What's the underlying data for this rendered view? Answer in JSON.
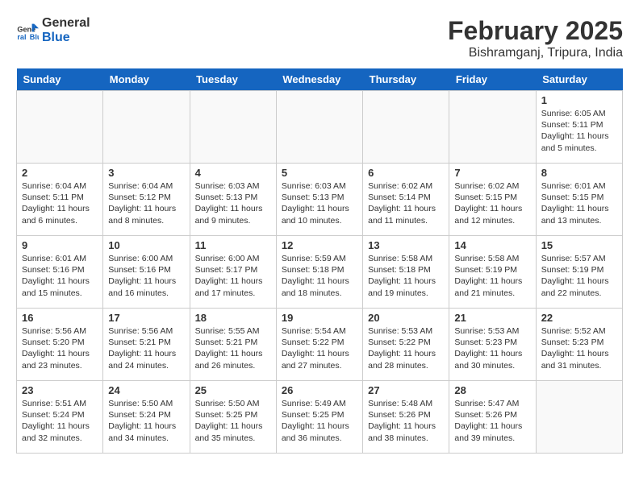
{
  "header": {
    "logo_line1": "General",
    "logo_line2": "Blue",
    "month": "February 2025",
    "location": "Bishramganj, Tripura, India"
  },
  "days_of_week": [
    "Sunday",
    "Monday",
    "Tuesday",
    "Wednesday",
    "Thursday",
    "Friday",
    "Saturday"
  ],
  "weeks": [
    [
      {
        "day": "",
        "info": ""
      },
      {
        "day": "",
        "info": ""
      },
      {
        "day": "",
        "info": ""
      },
      {
        "day": "",
        "info": ""
      },
      {
        "day": "",
        "info": ""
      },
      {
        "day": "",
        "info": ""
      },
      {
        "day": "1",
        "info": "Sunrise: 6:05 AM\nSunset: 5:11 PM\nDaylight: 11 hours and 5 minutes."
      }
    ],
    [
      {
        "day": "2",
        "info": "Sunrise: 6:04 AM\nSunset: 5:11 PM\nDaylight: 11 hours and 6 minutes."
      },
      {
        "day": "3",
        "info": "Sunrise: 6:04 AM\nSunset: 5:12 PM\nDaylight: 11 hours and 8 minutes."
      },
      {
        "day": "4",
        "info": "Sunrise: 6:03 AM\nSunset: 5:13 PM\nDaylight: 11 hours and 9 minutes."
      },
      {
        "day": "5",
        "info": "Sunrise: 6:03 AM\nSunset: 5:13 PM\nDaylight: 11 hours and 10 minutes."
      },
      {
        "day": "6",
        "info": "Sunrise: 6:02 AM\nSunset: 5:14 PM\nDaylight: 11 hours and 11 minutes."
      },
      {
        "day": "7",
        "info": "Sunrise: 6:02 AM\nSunset: 5:15 PM\nDaylight: 11 hours and 12 minutes."
      },
      {
        "day": "8",
        "info": "Sunrise: 6:01 AM\nSunset: 5:15 PM\nDaylight: 11 hours and 13 minutes."
      }
    ],
    [
      {
        "day": "9",
        "info": "Sunrise: 6:01 AM\nSunset: 5:16 PM\nDaylight: 11 hours and 15 minutes."
      },
      {
        "day": "10",
        "info": "Sunrise: 6:00 AM\nSunset: 5:16 PM\nDaylight: 11 hours and 16 minutes."
      },
      {
        "day": "11",
        "info": "Sunrise: 6:00 AM\nSunset: 5:17 PM\nDaylight: 11 hours and 17 minutes."
      },
      {
        "day": "12",
        "info": "Sunrise: 5:59 AM\nSunset: 5:18 PM\nDaylight: 11 hours and 18 minutes."
      },
      {
        "day": "13",
        "info": "Sunrise: 5:58 AM\nSunset: 5:18 PM\nDaylight: 11 hours and 19 minutes."
      },
      {
        "day": "14",
        "info": "Sunrise: 5:58 AM\nSunset: 5:19 PM\nDaylight: 11 hours and 21 minutes."
      },
      {
        "day": "15",
        "info": "Sunrise: 5:57 AM\nSunset: 5:19 PM\nDaylight: 11 hours and 22 minutes."
      }
    ],
    [
      {
        "day": "16",
        "info": "Sunrise: 5:56 AM\nSunset: 5:20 PM\nDaylight: 11 hours and 23 minutes."
      },
      {
        "day": "17",
        "info": "Sunrise: 5:56 AM\nSunset: 5:21 PM\nDaylight: 11 hours and 24 minutes."
      },
      {
        "day": "18",
        "info": "Sunrise: 5:55 AM\nSunset: 5:21 PM\nDaylight: 11 hours and 26 minutes."
      },
      {
        "day": "19",
        "info": "Sunrise: 5:54 AM\nSunset: 5:22 PM\nDaylight: 11 hours and 27 minutes."
      },
      {
        "day": "20",
        "info": "Sunrise: 5:53 AM\nSunset: 5:22 PM\nDaylight: 11 hours and 28 minutes."
      },
      {
        "day": "21",
        "info": "Sunrise: 5:53 AM\nSunset: 5:23 PM\nDaylight: 11 hours and 30 minutes."
      },
      {
        "day": "22",
        "info": "Sunrise: 5:52 AM\nSunset: 5:23 PM\nDaylight: 11 hours and 31 minutes."
      }
    ],
    [
      {
        "day": "23",
        "info": "Sunrise: 5:51 AM\nSunset: 5:24 PM\nDaylight: 11 hours and 32 minutes."
      },
      {
        "day": "24",
        "info": "Sunrise: 5:50 AM\nSunset: 5:24 PM\nDaylight: 11 hours and 34 minutes."
      },
      {
        "day": "25",
        "info": "Sunrise: 5:50 AM\nSunset: 5:25 PM\nDaylight: 11 hours and 35 minutes."
      },
      {
        "day": "26",
        "info": "Sunrise: 5:49 AM\nSunset: 5:25 PM\nDaylight: 11 hours and 36 minutes."
      },
      {
        "day": "27",
        "info": "Sunrise: 5:48 AM\nSunset: 5:26 PM\nDaylight: 11 hours and 38 minutes."
      },
      {
        "day": "28",
        "info": "Sunrise: 5:47 AM\nSunset: 5:26 PM\nDaylight: 11 hours and 39 minutes."
      },
      {
        "day": "",
        "info": ""
      }
    ]
  ]
}
